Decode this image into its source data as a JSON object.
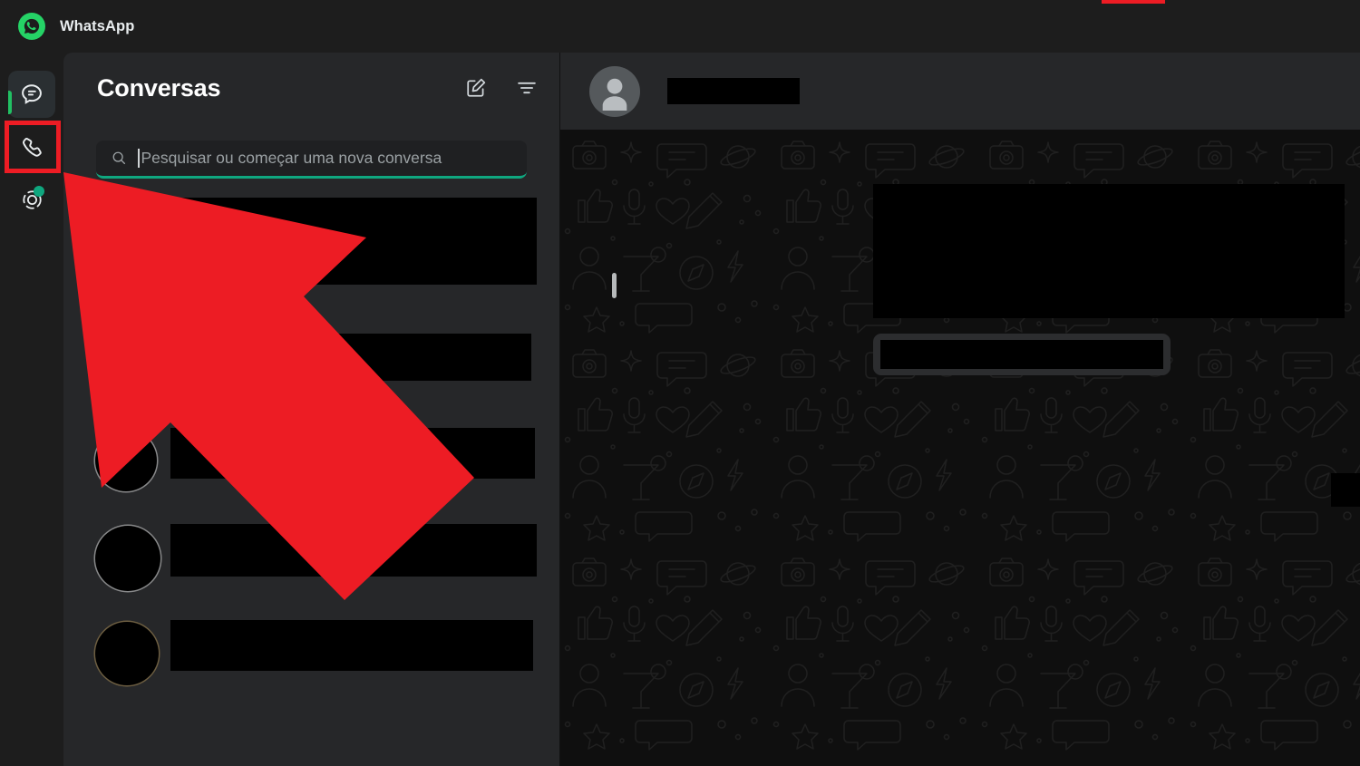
{
  "app": {
    "name": "WhatsApp",
    "logo_icon": "whatsapp-logo-icon",
    "accent_green": "#25d366",
    "annotation_red": "#ed1c24",
    "background": "#1d1d1d"
  },
  "rail": {
    "items": [
      {
        "id": "chats",
        "icon": "chat-bubble-icon",
        "label": "Conversas",
        "active": true,
        "badge": false
      },
      {
        "id": "calls",
        "icon": "phone-handset-icon",
        "label": "Chamadas",
        "active": false,
        "badge": false,
        "highlighted": true
      },
      {
        "id": "status",
        "icon": "status-circle-icon",
        "label": "Atualizações",
        "active": false,
        "badge": true,
        "badge_color": "#0fa77f"
      }
    ]
  },
  "chat_list": {
    "title": "Conversas",
    "actions": [
      {
        "id": "new-chat",
        "icon": "compose-icon"
      },
      {
        "id": "filter",
        "icon": "filter-icon"
      }
    ],
    "search": {
      "placeholder": "Pesquisar ou começar uma nova conversa",
      "value": "",
      "focused": true,
      "icon": "search-icon",
      "underline_color": "#0fa77f"
    },
    "rows": [
      {
        "id": "row-1",
        "redacted": true,
        "avatar_visible": false,
        "name_width": 0,
        "msg_width": 0
      },
      {
        "id": "row-2",
        "redacted": true,
        "avatar_visible": false,
        "name_width": 408,
        "msg_width": 0
      },
      {
        "id": "row-3",
        "redacted": true,
        "avatar_visible": false,
        "name_width": 408,
        "msg_width": 0
      },
      {
        "id": "row-4",
        "redacted": true,
        "avatar_visible": true,
        "name_width": 400,
        "msg_width": 0
      },
      {
        "id": "row-5",
        "redacted": true,
        "avatar_visible": true,
        "name_width": 404,
        "msg_width": 0
      },
      {
        "id": "row-6",
        "redacted": true,
        "avatar_visible": true,
        "name_width": 404,
        "msg_width": 0
      },
      {
        "id": "row-7",
        "redacted": true,
        "avatar_visible": true,
        "name_width": 400,
        "msg_width": 0
      }
    ],
    "scrollbar_visible": true
  },
  "conversation": {
    "contact_name_redacted": true,
    "avatar_icon": "default-person-avatar-icon",
    "wallpaper": "whatsapp-doodle-pattern",
    "messages": [
      {
        "id": "msg-1",
        "direction": "outgoing",
        "redacted": true
      },
      {
        "id": "msg-2",
        "direction": "outgoing",
        "redacted": true
      }
    ]
  },
  "annotation": {
    "arrow_color": "#ed1c24",
    "arrow_points_to": "phone-handset-icon",
    "highlight_target": "calls-rail-button",
    "highlight_color": "#ed1c24"
  }
}
